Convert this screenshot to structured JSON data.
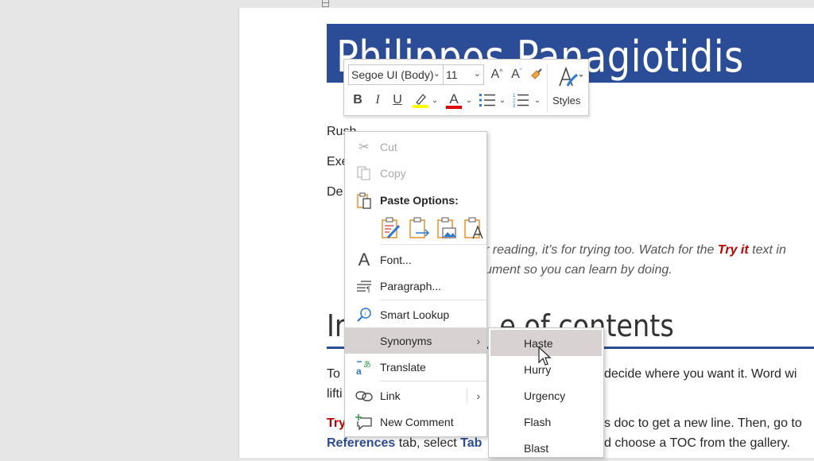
{
  "document": {
    "title": "Philippos Panagiotidis",
    "lines": {
      "line1": "Rush",
      "line2": "Exe",
      "line3": "De",
      "italic1_pre": "r reading, it’s for trying too. Watch for the ",
      "italic1_try": "Try it",
      "italic1_post": " text in",
      "italic2": "ument so you can learn by doing.",
      "heading": "Insert a table of contents",
      "heading_visible_left": "Ir",
      "heading_visible_right": "e of contents",
      "p1_left": "To",
      "p1_right": " decide where you want it. Word wi",
      "p2_left": "lifti",
      "p3_try": "Try",
      "p3_right": "s doc to get a new line. Then, go to",
      "p4_refs": "References",
      "p4_mid": " tab, select ",
      "p4_tab": "Tab",
      "p4_right": "d choose a TOC from the gallery."
    },
    "colors": {
      "accent": "#2b4c96",
      "try_red": "#c00000"
    }
  },
  "minibar": {
    "font_name": "Segoe UI (Body)",
    "font_size": "11",
    "grow_font": "A",
    "shrink_font": "A",
    "bold": "B",
    "italic": "I",
    "underline": "U",
    "font_color_glyph": "A",
    "styles_label": "Styles",
    "highlight_color": "#ffff00",
    "font_color": "#e00000"
  },
  "context_menu": {
    "items": [
      {
        "label": "Cut",
        "icon": "scissors-icon",
        "disabled": true
      },
      {
        "label": "Copy",
        "icon": "copy-icon",
        "disabled": true
      },
      {
        "label": "Paste Options:",
        "icon": "clipboard-icon"
      },
      {
        "label": "Font...",
        "icon": "font-icon"
      },
      {
        "label": "Paragraph...",
        "icon": "paragraph-icon"
      },
      {
        "label": "Smart Lookup",
        "icon": "search-icon"
      },
      {
        "label": "Synonyms",
        "icon": "",
        "submenu": true,
        "highlighted": true
      },
      {
        "label": "Translate",
        "icon": "translate-icon"
      },
      {
        "label": "Link",
        "icon": "link-icon",
        "submenu": true
      },
      {
        "label": "New Comment",
        "icon": "new-comment-icon"
      }
    ],
    "paste_options": [
      "Keep Source Formatting",
      "Merge Formatting",
      "Picture",
      "Keep Text Only"
    ]
  },
  "synonyms_submenu": {
    "items": [
      "Haste",
      "Hurry",
      "Urgency",
      "Flash",
      "Blast"
    ],
    "highlighted": "Haste"
  }
}
